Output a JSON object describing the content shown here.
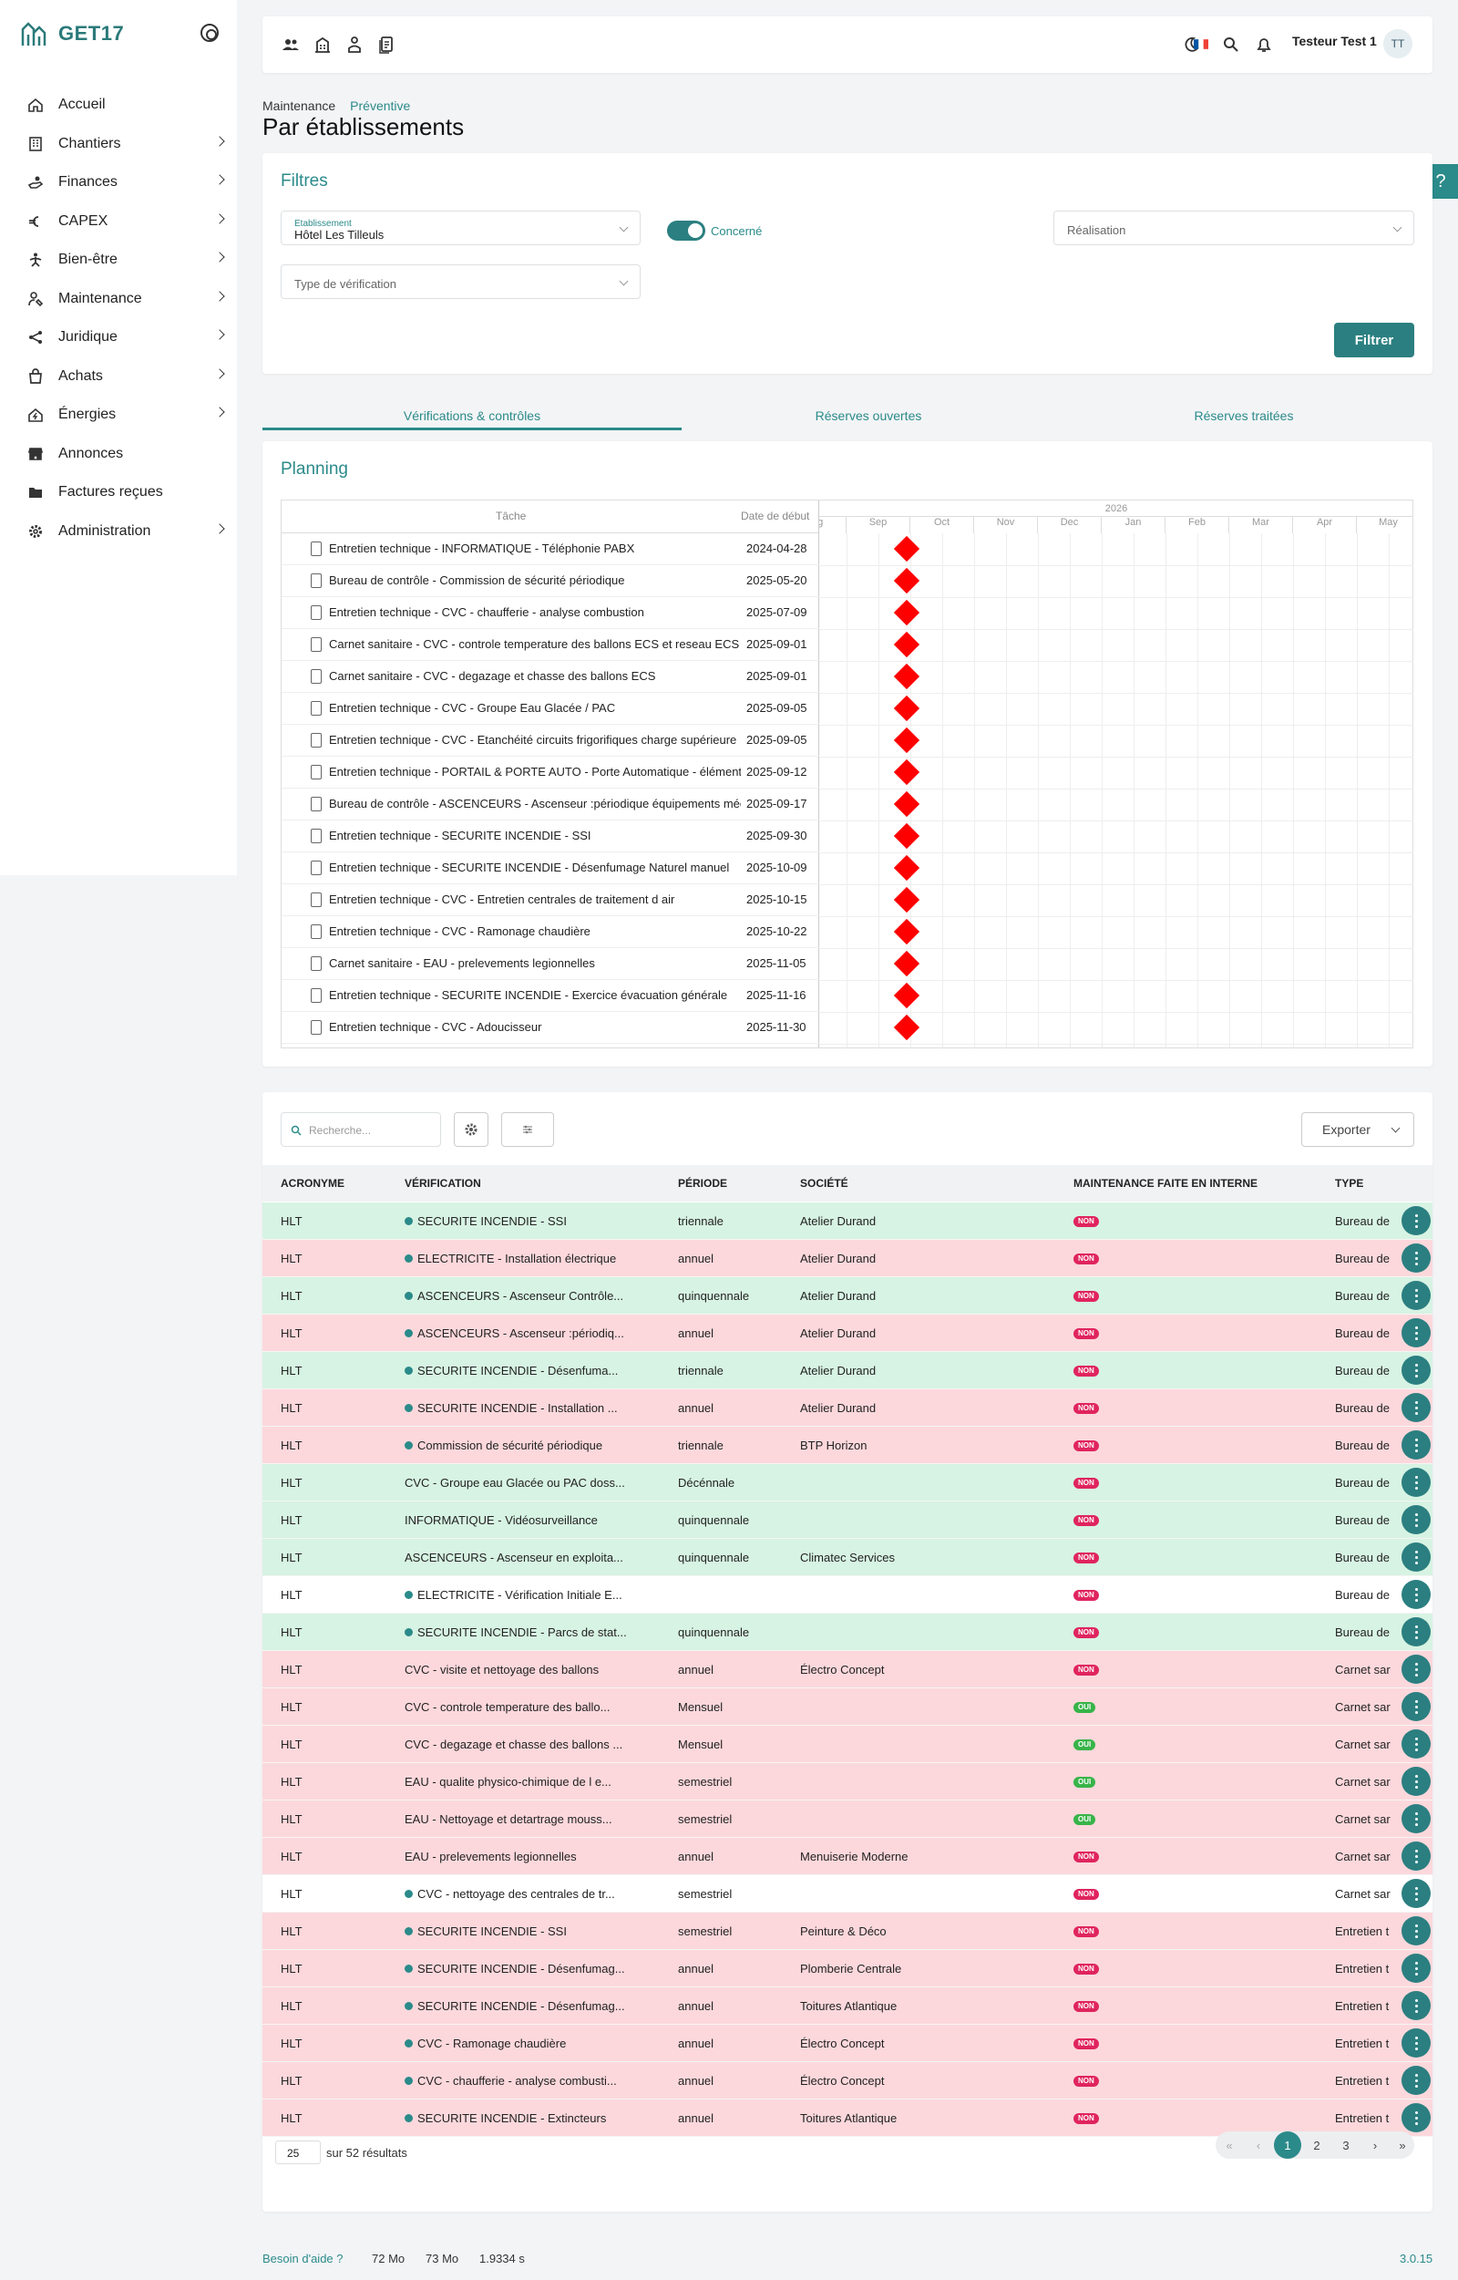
{
  "app": {
    "logo_text": "GET17",
    "version": "3.0.15"
  },
  "sidebar": {
    "items": [
      {
        "label": "Accueil",
        "icon": "home-icon",
        "has_children": false
      },
      {
        "label": "Chantiers",
        "icon": "building-icon",
        "has_children": true
      },
      {
        "label": "Finances",
        "icon": "hand-coins-icon",
        "has_children": true
      },
      {
        "label": "CAPEX",
        "icon": "euro-icon",
        "has_children": true
      },
      {
        "label": "Bien-être",
        "icon": "wellbeing-icon",
        "has_children": true
      },
      {
        "label": "Maintenance",
        "icon": "maintenance-icon",
        "has_children": true
      },
      {
        "label": "Juridique",
        "icon": "share-icon",
        "has_children": true
      },
      {
        "label": "Achats",
        "icon": "shopping-bag-icon",
        "has_children": true
      },
      {
        "label": "Énergies",
        "icon": "energy-home-icon",
        "has_children": true
      },
      {
        "label": "Annonces",
        "icon": "store-icon",
        "has_children": false
      },
      {
        "label": "Factures reçues",
        "icon": "folder-icon",
        "has_children": false
      },
      {
        "label": "Administration",
        "icon": "settings-icon",
        "has_children": true
      }
    ]
  },
  "topbar": {
    "user_name": "Testeur Test 1",
    "avatar_initials": "TT"
  },
  "breadcrumb": {
    "parent": "Maintenance",
    "current": "Préventive"
  },
  "page_title": "Par établissements",
  "filters": {
    "title": "Filtres",
    "establishment_label": "Etablissement",
    "establishment_value": "Hôtel Les Tilleuls",
    "concerned_label": "Concerné",
    "concerned_on": true,
    "realisation_placeholder": "Réalisation",
    "verification_type_placeholder": "Type de vérification",
    "filter_button": "Filtrer"
  },
  "tabs": [
    {
      "label": "Vérifications & contrôles",
      "active": true
    },
    {
      "label": "Réserves ouvertes",
      "active": false
    },
    {
      "label": "Réserves traitées",
      "active": false
    }
  ],
  "planning": {
    "title": "Planning",
    "col_task": "Tâche",
    "col_start": "Date de début",
    "year": "2026",
    "months": [
      "Aug",
      "Sep",
      "Oct",
      "Nov",
      "Dec",
      "Jan",
      "Feb",
      "Mar",
      "Apr",
      "May"
    ],
    "tasks": [
      {
        "name": "Entretien technique - INFORMATIQUE - Téléphonie PABX",
        "date": "2024-04-28"
      },
      {
        "name": "Bureau de contrôle - Commission de sécurité périodique",
        "date": "2025-05-20"
      },
      {
        "name": "Entretien technique - CVC - chaufferie - analyse combustion",
        "date": "2025-07-09"
      },
      {
        "name": "Carnet sanitaire - CVC - controle temperature des ballons ECS et reseau ECS",
        "date": "2025-09-01"
      },
      {
        "name": "Carnet sanitaire - CVC - degazage et chasse des ballons ECS",
        "date": "2025-09-01"
      },
      {
        "name": "Entretien technique - CVC - Groupe Eau Glacée / PAC",
        "date": "2025-09-05"
      },
      {
        "name": "Entretien technique - CVC - Etanchéité circuits frigorifiques charge supérieure",
        "date": "2025-09-05"
      },
      {
        "name": "Entretien technique - PORTAIL & PORTE AUTO - Porte Automatique - éléments",
        "date": "2025-09-12"
      },
      {
        "name": "Bureau de contrôle - ASCENCEURS - Ascenseur :périodique équipements mécaniques",
        "date": "2025-09-17"
      },
      {
        "name": "Entretien technique - SECURITE INCENDIE - SSI",
        "date": "2025-09-30"
      },
      {
        "name": "Entretien technique - SECURITE INCENDIE - Désenfumage Naturel manuel",
        "date": "2025-10-09"
      },
      {
        "name": "Entretien technique - CVC - Entretien centrales de traitement d air",
        "date": "2025-10-15"
      },
      {
        "name": "Entretien technique - CVC - Ramonage chaudière",
        "date": "2025-10-22"
      },
      {
        "name": "Carnet sanitaire - EAU - prelevements legionnelles",
        "date": "2025-11-05"
      },
      {
        "name": "Entretien technique - SECURITE INCENDIE - Exercice évacuation générale",
        "date": "2025-11-16"
      },
      {
        "name": "Entretien technique - CVC - Adoucisseur",
        "date": "2025-11-30"
      }
    ]
  },
  "table": {
    "search_placeholder": "Recherche...",
    "export_label": "Exporter",
    "columns": [
      "ACRONYME",
      "VÉRIFICATION",
      "PÉRIODE",
      "SOCIÉTÉ",
      "MAINTENANCE FAITE EN INTERNE",
      "TYPE"
    ],
    "rows": [
      {
        "status": "green",
        "acronym": "HLT",
        "dot": true,
        "verification": "SECURITE INCENDIE - SSI",
        "period": "triennale",
        "company": "Atelier Durand",
        "internal": "NON",
        "type": "Bureau de"
      },
      {
        "status": "red",
        "acronym": "HLT",
        "dot": true,
        "verification": "ELECTRICITE - Installation électrique",
        "period": "annuel",
        "company": "Atelier Durand",
        "internal": "NON",
        "type": "Bureau de"
      },
      {
        "status": "green",
        "acronym": "HLT",
        "dot": true,
        "verification": "ASCENCEURS - Ascenseur Contrôle...",
        "period": "quinquennale",
        "company": "Atelier Durand",
        "internal": "NON",
        "type": "Bureau de"
      },
      {
        "status": "red",
        "acronym": "HLT",
        "dot": true,
        "verification": "ASCENCEURS - Ascenseur :périodiq...",
        "period": "annuel",
        "company": "Atelier Durand",
        "internal": "NON",
        "type": "Bureau de"
      },
      {
        "status": "green",
        "acronym": "HLT",
        "dot": true,
        "verification": "SECURITE INCENDIE - Désenfuma...",
        "period": "triennale",
        "company": "Atelier Durand",
        "internal": "NON",
        "type": "Bureau de"
      },
      {
        "status": "red",
        "acronym": "HLT",
        "dot": true,
        "verification": "SECURITE INCENDIE - Installation ...",
        "period": "annuel",
        "company": "Atelier Durand",
        "internal": "NON",
        "type": "Bureau de"
      },
      {
        "status": "red",
        "acronym": "HLT",
        "dot": true,
        "verification": "Commission de sécurité périodique",
        "period": "triennale",
        "company": "BTP Horizon",
        "internal": "NON",
        "type": "Bureau de"
      },
      {
        "status": "green",
        "acronym": "HLT",
        "dot": false,
        "verification": "CVC - Groupe eau Glacée ou PAC doss...",
        "period": "Décénnale",
        "company": "",
        "internal": "NON",
        "type": "Bureau de"
      },
      {
        "status": "green",
        "acronym": "HLT",
        "dot": false,
        "verification": "INFORMATIQUE - Vidéosurveillance",
        "period": "quinquennale",
        "company": "",
        "internal": "NON",
        "type": "Bureau de"
      },
      {
        "status": "green",
        "acronym": "HLT",
        "dot": false,
        "verification": "ASCENCEURS - Ascenseur en exploita...",
        "period": "quinquennale",
        "company": "Climatec Services",
        "internal": "NON",
        "type": "Bureau de"
      },
      {
        "status": "white",
        "acronym": "HLT",
        "dot": true,
        "verification": "ELECTRICITE - Vérification Initiale E...",
        "period": "",
        "company": "",
        "internal": "NON",
        "type": "Bureau de"
      },
      {
        "status": "green",
        "acronym": "HLT",
        "dot": true,
        "verification": "SECURITE INCENDIE - Parcs de stat...",
        "period": "quinquennale",
        "company": "",
        "internal": "NON",
        "type": "Bureau de"
      },
      {
        "status": "red",
        "acronym": "HLT",
        "dot": false,
        "verification": "CVC - visite et nettoyage des ballons",
        "period": "annuel",
        "company": "Électro Concept",
        "internal": "NON",
        "type": "Carnet sar"
      },
      {
        "status": "red",
        "acronym": "HLT",
        "dot": false,
        "verification": "CVC - controle temperature des ballo...",
        "period": "Mensuel",
        "company": "",
        "internal": "OUI",
        "type": "Carnet sar"
      },
      {
        "status": "red",
        "acronym": "HLT",
        "dot": false,
        "verification": "CVC - degazage et chasse des ballons ...",
        "period": "Mensuel",
        "company": "",
        "internal": "OUI",
        "type": "Carnet sar"
      },
      {
        "status": "red",
        "acronym": "HLT",
        "dot": false,
        "verification": "EAU - qualite physico-chimique de l e...",
        "period": "semestriel",
        "company": "",
        "internal": "OUI",
        "type": "Carnet sar"
      },
      {
        "status": "red",
        "acronym": "HLT",
        "dot": false,
        "verification": "EAU - Nettoyage et detartrage mouss...",
        "period": "semestriel",
        "company": "",
        "internal": "OUI",
        "type": "Carnet sar"
      },
      {
        "status": "red",
        "acronym": "HLT",
        "dot": false,
        "verification": "EAU - prelevements legionnelles",
        "period": "annuel",
        "company": "Menuiserie Moderne",
        "internal": "NON",
        "type": "Carnet sar"
      },
      {
        "status": "white",
        "acronym": "HLT",
        "dot": true,
        "verification": "CVC - nettoyage des centrales de tr...",
        "period": "semestriel",
        "company": "",
        "internal": "NON",
        "type": "Carnet sar"
      },
      {
        "status": "red",
        "acronym": "HLT",
        "dot": true,
        "verification": "SECURITE INCENDIE - SSI",
        "period": "semestriel",
        "company": "Peinture & Déco",
        "internal": "NON",
        "type": "Entretien t"
      },
      {
        "status": "red",
        "acronym": "HLT",
        "dot": true,
        "verification": "SECURITE INCENDIE - Désenfumag...",
        "period": "annuel",
        "company": "Plomberie Centrale",
        "internal": "NON",
        "type": "Entretien t"
      },
      {
        "status": "red",
        "acronym": "HLT",
        "dot": true,
        "verification": "SECURITE INCENDIE - Désenfumag...",
        "period": "annuel",
        "company": "Toitures Atlantique",
        "internal": "NON",
        "type": "Entretien t"
      },
      {
        "status": "red",
        "acronym": "HLT",
        "dot": true,
        "verification": "CVC - Ramonage chaudière",
        "period": "annuel",
        "company": "Électro Concept",
        "internal": "NON",
        "type": "Entretien t"
      },
      {
        "status": "red",
        "acronym": "HLT",
        "dot": true,
        "verification": "CVC - chaufferie - analyse combusti...",
        "period": "annuel",
        "company": "Électro Concept",
        "internal": "NON",
        "type": "Entretien t"
      },
      {
        "status": "red",
        "acronym": "HLT",
        "dot": true,
        "verification": "SECURITE INCENDIE - Extincteurs",
        "period": "annuel",
        "company": "Toitures Atlantique",
        "internal": "NON",
        "type": "Entretien t"
      }
    ]
  },
  "pagination": {
    "per_page": "25",
    "results_text": "sur 52 résultats",
    "first": "«",
    "prev": "‹",
    "pages": [
      "1",
      "2",
      "3"
    ],
    "current": "1",
    "next": "›",
    "last": "»"
  },
  "footer": {
    "help": "Besoin d'aide ?",
    "mem1": "72 Mo",
    "mem2": "73 Mo",
    "time": "1.9334 s"
  }
}
